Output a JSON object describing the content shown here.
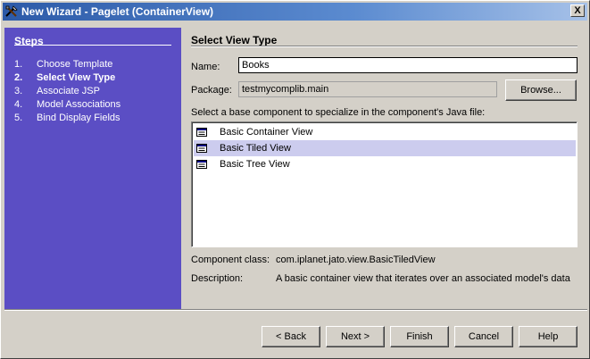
{
  "window": {
    "title": "New Wizard - Pagelet (ContainerView)",
    "close_glyph": "X"
  },
  "colors": {
    "sidebar_bg": "#5b4ec4",
    "selected_row": "#ccccee",
    "titlebar_start": "#2c5aa8"
  },
  "sidebar": {
    "title": "Steps",
    "steps": [
      {
        "num": "1.",
        "label": "Choose Template",
        "active": false
      },
      {
        "num": "2.",
        "label": "Select View Type",
        "active": true
      },
      {
        "num": "3.",
        "label": "Associate JSP",
        "active": false
      },
      {
        "num": "4.",
        "label": "Model Associations",
        "active": false
      },
      {
        "num": "5.",
        "label": "Bind Display Fields",
        "active": false
      }
    ]
  },
  "main": {
    "section_title": "Select View Type",
    "name_label": "Name:",
    "name_value": "Books",
    "package_label": "Package:",
    "package_value": "testmycomplib.main",
    "browse_button": "Browse...",
    "list_prompt": "Select a base component to specialize in the component's Java file:",
    "components": [
      {
        "label": "Basic Container View",
        "icon": "component-icon",
        "selected": false
      },
      {
        "label": "Basic Tiled View",
        "icon": "component-icon",
        "selected": true
      },
      {
        "label": "Basic Tree View",
        "icon": "component-icon",
        "selected": false
      }
    ],
    "component_class_label": "Component class:",
    "component_class_value": "com.iplanet.jato.view.BasicTiledView",
    "description_label": "Description:",
    "description_value": "A basic container view that iterates over an associated model's data"
  },
  "footer": {
    "back_label": "< Back",
    "next_label": "Next >",
    "finish_label": "Finish",
    "cancel_label": "Cancel",
    "help_label": "Help"
  }
}
